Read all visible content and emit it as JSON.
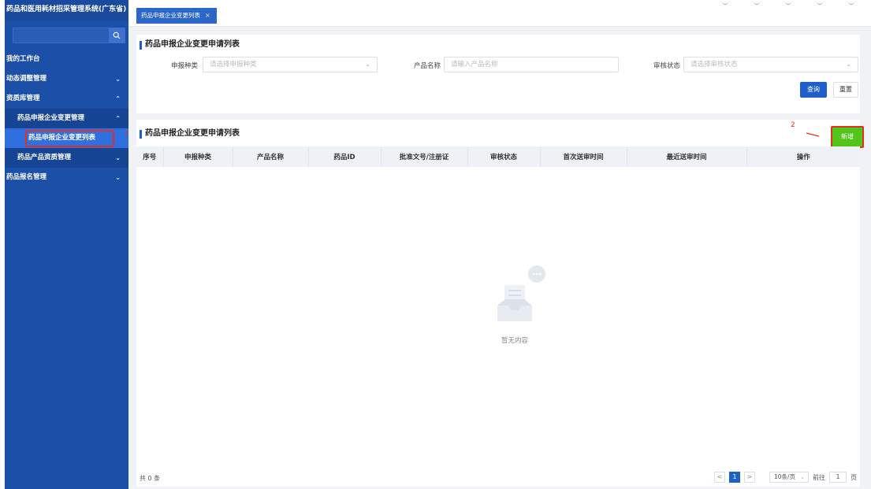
{
  "app": {
    "title": "药品和医用耗材招采管理系统(广东省)"
  },
  "tabs": [
    {
      "label": "药品申报企业变更列表",
      "close": "×"
    }
  ],
  "sidebar": {
    "items": [
      {
        "label": "我的工作台"
      },
      {
        "label": "动态调整管理",
        "chevron": "⌄"
      },
      {
        "label": "资质库管理",
        "chevron": "⌃"
      },
      {
        "label": "药品申报企业变更管理",
        "chevron": "⌃"
      },
      {
        "label": "药品申报企业变更列表"
      },
      {
        "label": "药品产品资质管理",
        "chevron": "⌄"
      },
      {
        "label": "药品报名管理",
        "chevron": "⌄"
      }
    ]
  },
  "filters": {
    "title": "药品申报企业变更申请列表",
    "type_label": "申报种类",
    "type_placeholder": "请选择申报种类",
    "name_label": "产品名称",
    "name_placeholder": "请输入产品名称",
    "status_label": "审核状态",
    "status_placeholder": "请选择审核状态",
    "query_label": "查询",
    "reset_label": "重置"
  },
  "list": {
    "title": "药品申报企业变更申请列表",
    "add_label": "新增",
    "columns": [
      "序号",
      "申报种类",
      "产品名称",
      "药品ID",
      "批准文号/注册证",
      "审核状态",
      "首次送审时间",
      "最近送审时间",
      "操作"
    ],
    "empty_text": "暂无内容"
  },
  "pagination": {
    "total_text": "共 0 条",
    "prev": "<",
    "current_page": "1",
    "next": ">",
    "page_size": "10条/页",
    "goto_label": "前往",
    "goto_value": "1",
    "page_unit": "页"
  },
  "annotations": {
    "step1": "1",
    "step2": "2"
  },
  "colors": {
    "sidebar": "#1b4fa8",
    "primary": "#1f5fc9",
    "success": "#52c41a",
    "annotation": "#e0311f"
  }
}
